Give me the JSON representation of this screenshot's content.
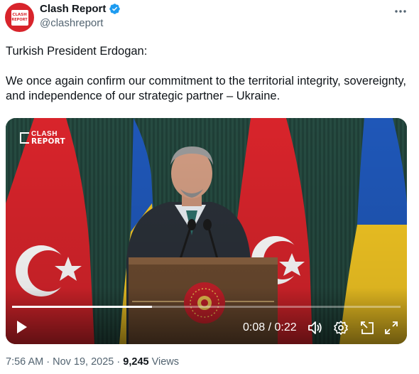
{
  "author": {
    "display_name": "Clash Report",
    "handle": "@clashreport",
    "avatar_text_1": "CLASH",
    "avatar_text_2": "REPORT",
    "verified_icon": "verified-badge-icon",
    "more_icon": "more-options-icon"
  },
  "tweet": {
    "line_1": "Turkish President Erdogan:",
    "line_2": "We once again confirm our commitment to the territorial integrity, sovereignty, and independence of our strategic partner – Ukraine."
  },
  "video": {
    "watermark_line_1": "CLASH",
    "watermark_line_2": "REPORT",
    "progress_fraction": 0.36,
    "time_display": "0:08 / 0:22",
    "icons": [
      "play-icon",
      "volume-icon",
      "settings-icon",
      "picture-in-picture-icon",
      "fullscreen-icon"
    ],
    "colors": {
      "turkish_red": "#d8242b",
      "ukraine_blue": "#1f57b8",
      "ukraine_yellow": "#f3c623",
      "curtain_green": "#1f3f37",
      "podium_brown": "#6b4a2f"
    }
  },
  "footer": {
    "time": "7:56 AM",
    "separator": "·",
    "date": "Nov 19, 2025",
    "views_count": "9,245",
    "views_label": "Views"
  }
}
